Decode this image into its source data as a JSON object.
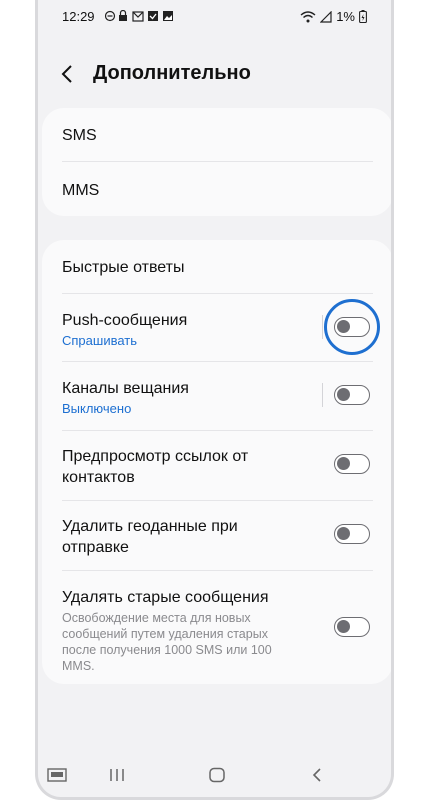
{
  "status": {
    "time": "12:29",
    "battery": "1%",
    "icons": [
      "dnd-icon",
      "lock-icon",
      "gmail-icon",
      "mail-check-icon",
      "gallery-icon",
      "wifi-icon",
      "signal-icon",
      "battery-icon"
    ]
  },
  "header": {
    "back_icon": "chevron-left-icon",
    "title": "Дополнительно"
  },
  "section1": {
    "items": [
      {
        "label": "SMS"
      },
      {
        "label": "MMS"
      }
    ]
  },
  "section2": {
    "items": [
      {
        "label": "Быстрые ответы"
      },
      {
        "label": "Push-сообщения",
        "sub": "Спрашивать",
        "toggle": false
      },
      {
        "label": "Каналы вещания",
        "sub": "Выключено",
        "toggle": false
      },
      {
        "label": "Предпросмотр ссылок от контактов",
        "toggle": false
      },
      {
        "label": "Удалить геоданные при отправке",
        "toggle": false
      },
      {
        "label": "Удалять старые сообщения",
        "desc": "Освобождение места для новых сообщений путем удаления старых после получения 1000 SMS или 100 MMS.",
        "toggle": false
      }
    ]
  },
  "colors": {
    "accent": "#1e6fd0",
    "background": "#f2f2f4",
    "card": "#fafafb"
  },
  "navbar": {
    "icons": [
      "keyboard-icon",
      "recent-apps-icon",
      "home-icon",
      "back-icon"
    ]
  }
}
